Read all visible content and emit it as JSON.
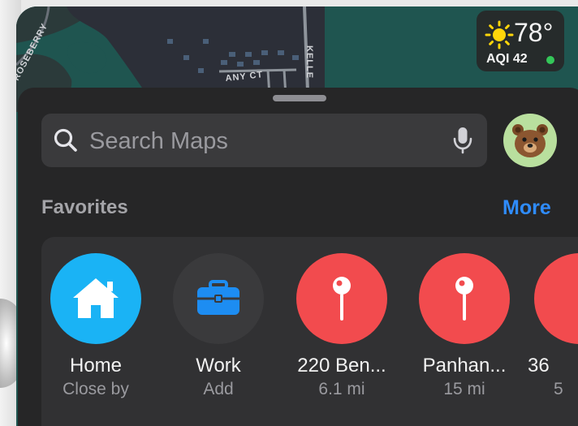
{
  "map": {
    "streets": [
      "ROSEBERRY",
      "ANY CT",
      "KELLE"
    ]
  },
  "weather": {
    "temperature": "78°",
    "aqi_label": "AQI 42",
    "aqi_dot_color": "#34c759",
    "icon": "sun-icon"
  },
  "search": {
    "placeholder": "Search Maps",
    "icon": "search-icon",
    "voice_icon": "microphone-icon"
  },
  "profile": {
    "avatar": "bear-avatar"
  },
  "favorites": {
    "title": "Favorites",
    "more_label": "More",
    "items": [
      {
        "name": "Home",
        "detail": "Close by",
        "icon": "house-icon",
        "color": "#1ab3f5"
      },
      {
        "name": "Work",
        "detail": "Add",
        "icon": "briefcase-icon",
        "color": "#3a3a3c"
      },
      {
        "name": "220 Ben...",
        "detail": "6.1 mi",
        "icon": "pin-icon",
        "color": "#f24b4e"
      },
      {
        "name": "Panhan...",
        "detail": "15 mi",
        "icon": "pin-icon",
        "color": "#f24b4e"
      },
      {
        "name": "36",
        "detail": "5",
        "icon": "pin-icon",
        "color": "#f24b4e"
      }
    ]
  },
  "colors": {
    "accent": "#2f8cff",
    "sheet_background": "#262627",
    "map_water": "#1f5550"
  }
}
